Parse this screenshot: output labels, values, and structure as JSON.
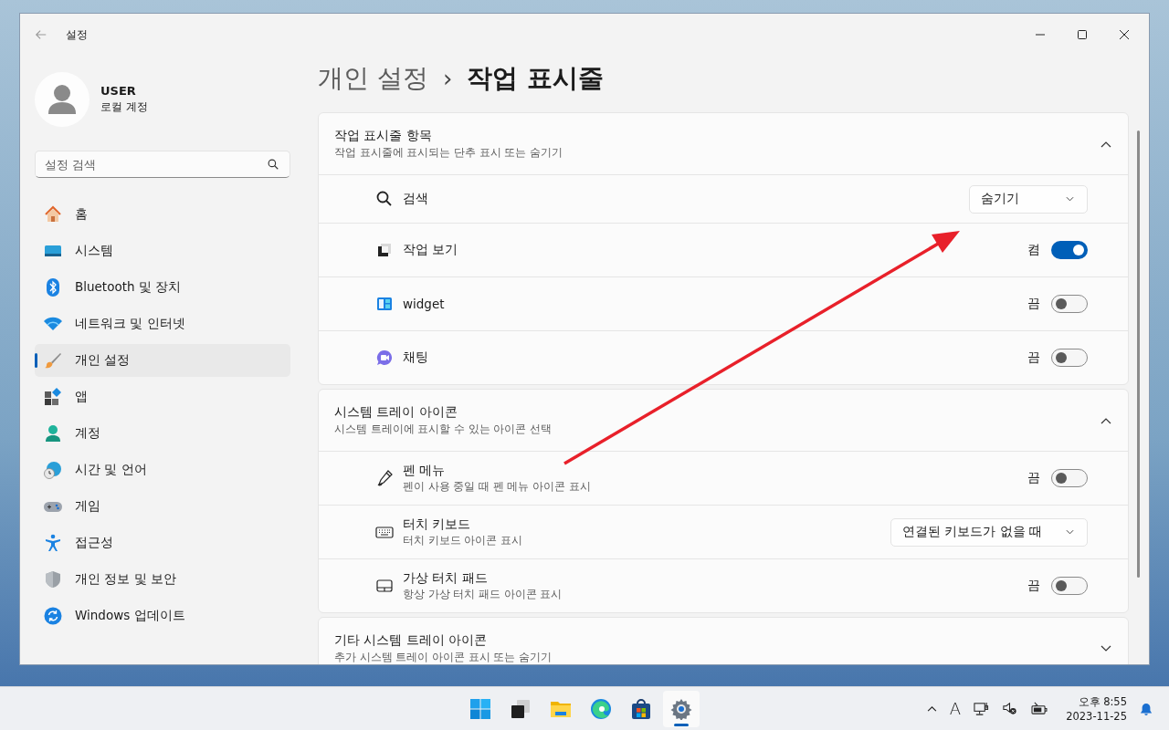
{
  "window": {
    "title": "설정"
  },
  "account": {
    "name": "USER",
    "type": "로컬 계정"
  },
  "search": {
    "placeholder": "설정 검색"
  },
  "sidebar": {
    "items": [
      {
        "label": "홈",
        "selected": false
      },
      {
        "label": "시스템",
        "selected": false
      },
      {
        "label": "Bluetooth 및 장치",
        "selected": false
      },
      {
        "label": "네트워크 및 인터넷",
        "selected": false
      },
      {
        "label": "개인 설정",
        "selected": true
      },
      {
        "label": "앱",
        "selected": false
      },
      {
        "label": "계정",
        "selected": false
      },
      {
        "label": "시간 및 언어",
        "selected": false
      },
      {
        "label": "게임",
        "selected": false
      },
      {
        "label": "접근성",
        "selected": false
      },
      {
        "label": "개인 정보 및 보안",
        "selected": false
      },
      {
        "label": "Windows 업데이트",
        "selected": false
      }
    ]
  },
  "breadcrumb": {
    "parent": "개인 설정",
    "separator": "›",
    "current": "작업 표시줄"
  },
  "sections": [
    {
      "title": "작업 표시줄 항목",
      "subtitle": "작업 표시줄에 표시되는 단추 표시 또는 숨기기",
      "expanded": true,
      "rows": [
        {
          "kind": "dropdown",
          "label": "검색",
          "value": "숨기기"
        },
        {
          "kind": "toggle",
          "label": "작업 보기",
          "state_label": "켬",
          "on": true
        },
        {
          "kind": "toggle",
          "label": "widget",
          "state_label": "끔",
          "on": false
        },
        {
          "kind": "toggle",
          "label": "채팅",
          "state_label": "끔",
          "on": false
        }
      ]
    },
    {
      "title": "시스템 트레이 아이콘",
      "subtitle": "시스템 트레이에 표시할 수 있는 아이콘 선택",
      "expanded": true,
      "rows": [
        {
          "kind": "toggle",
          "label": "펜 메뉴",
          "description": "펜이 사용 중일 때 펜 메뉴 아이콘 표시",
          "state_label": "끔",
          "on": false
        },
        {
          "kind": "dropdown",
          "label": "터치 키보드",
          "description": "터치 키보드 아이콘 표시",
          "value": "연결된 키보드가 없을 때"
        },
        {
          "kind": "toggle",
          "label": "가상 터치 패드",
          "description": "항상 가상 터치 패드 아이콘 표시",
          "state_label": "끔",
          "on": false
        }
      ]
    },
    {
      "title": "기타 시스템 트레이 아이콘",
      "subtitle": "추가 시스템 트레이 아이콘 표시 또는 숨기기",
      "expanded": false
    }
  ],
  "taskbar": {
    "apps": [
      {
        "selected": false
      },
      {
        "selected": false
      },
      {
        "selected": false
      },
      {
        "selected": false
      },
      {
        "selected": false
      },
      {
        "selected": true
      }
    ],
    "ime": "A",
    "time": "오후 8:55",
    "date": "2023-11-25"
  }
}
